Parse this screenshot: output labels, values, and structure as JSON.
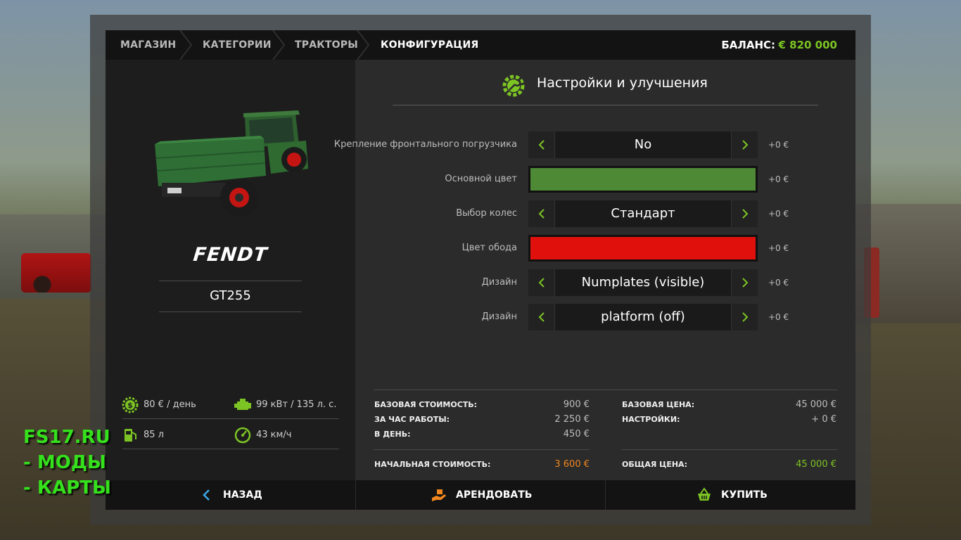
{
  "breadcrumb": {
    "items": [
      {
        "label": "МАГАЗИН",
        "active": false
      },
      {
        "label": "КАТЕГОРИИ",
        "active": false
      },
      {
        "label": "ТРАКТОРЫ",
        "active": false
      },
      {
        "label": "КОНФИГУРАЦИЯ",
        "active": true
      }
    ]
  },
  "balance": {
    "label": "БАЛАНС:",
    "value": "€ 820 000"
  },
  "vehicle": {
    "brand": "FENDT",
    "model": "GT255",
    "stats": {
      "rent": "80 € / день",
      "power": "99 кВт / 135 л. с.",
      "fuel": "85 л",
      "speed": "43 км/ч"
    }
  },
  "config": {
    "title": "Настройки и улучшения",
    "rows": [
      {
        "label": "Крепление фронтального погрузчика",
        "type": "select",
        "value": "No",
        "price": "+0 €"
      },
      {
        "label": "Основной цвет",
        "type": "color",
        "color": "#4e8a35",
        "price": "+0 €"
      },
      {
        "label": "Выбор колес",
        "type": "select",
        "value": "Стандарт",
        "price": "+0 €"
      },
      {
        "label": "Цвет обода",
        "type": "color",
        "color": "#e0100c",
        "price": "+0 €"
      },
      {
        "label": "Дизайн",
        "type": "select",
        "value": "Numplates (visible)",
        "price": "+0 €"
      },
      {
        "label": "Дизайн",
        "type": "select",
        "value": "platform (off)",
        "price": "+0 €"
      }
    ]
  },
  "costs": {
    "base_cost": {
      "label": "БАЗОВАЯ СТОИМОСТЬ:",
      "value": "900 €"
    },
    "per_hour": {
      "label": "ЗА ЧАС РАБОТЫ:",
      "value": "2 250 €"
    },
    "per_day": {
      "label": "В ДЕНЬ:",
      "value": "450 €"
    },
    "initial_cost": {
      "label": "НАЧАЛЬНАЯ СТОИМОСТЬ:",
      "value": "3 600 €"
    },
    "base_price": {
      "label": "БАЗОВАЯ ЦЕНА:",
      "value": "45 000 €"
    },
    "settings": {
      "label": "НАСТРОЙКИ:",
      "value": "+ 0 €"
    },
    "total_price": {
      "label": "ОБЩАЯ ЦЕНА:",
      "value": "45 000 €"
    }
  },
  "footer": {
    "back": "НАЗАД",
    "rent": "АРЕНДОВАТЬ",
    "buy": "КУПИТЬ"
  },
  "watermark": [
    "FS17.RU",
    " - МОДЫ",
    " - КАРТЫ"
  ],
  "colors": {
    "accent": "#7cc423",
    "orange": "#f0861e"
  }
}
